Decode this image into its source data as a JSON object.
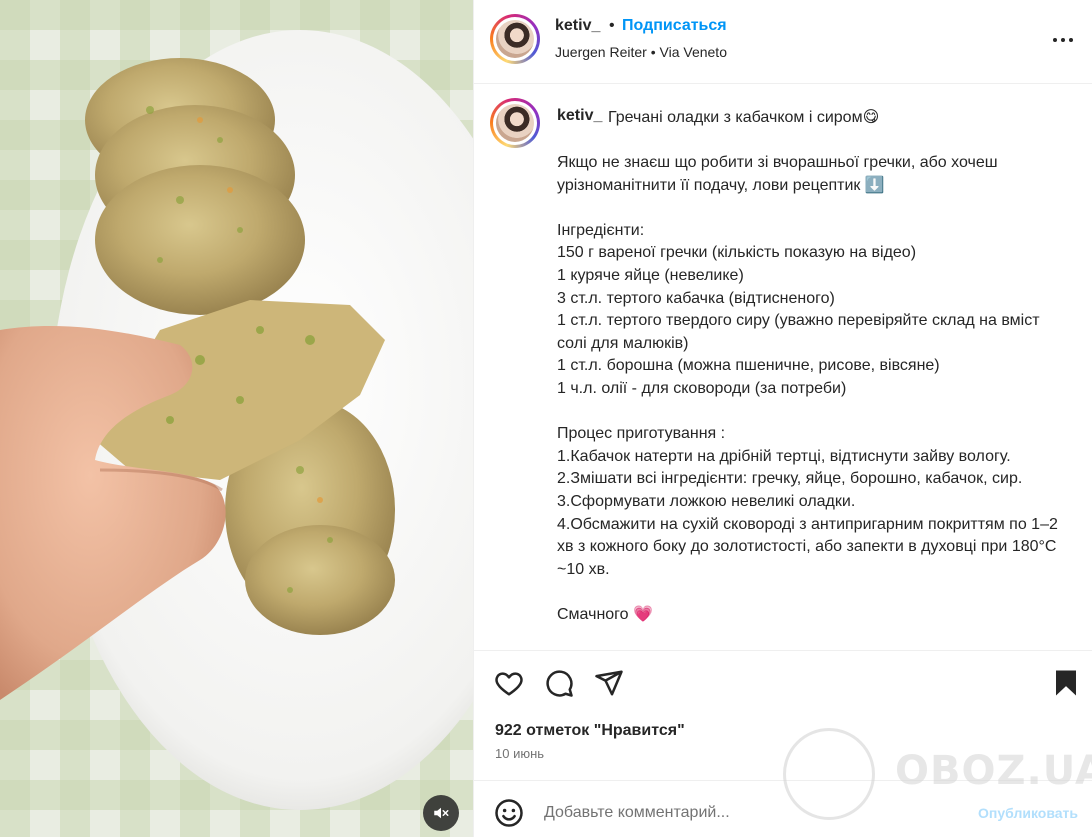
{
  "header": {
    "username": "ketiv_",
    "separator": "•",
    "follow_label": "Подписаться",
    "location": "Juergen Reiter • Via Veneto",
    "more_icon": "more-horizontal-icon"
  },
  "caption": {
    "username": "ketiv_",
    "title": "Гречані оладки з кабачком і сиром😋",
    "body": "Якщо не знаєш що робити зі вчорашньої гречки, або хочеш урізноманітнити її подачу, лови рецептик ⬇️\n\nІнгредієнти:\n150 г вареної гречки (кількість показую на відео)\n1 куряче яйце (невелике)\n3 ст.л. тертого кабачка (відтисненого)\n1 ст.л. тертого твердого сиру (уважно перевіряйте склад на вміст солі для малюків)\n1 ст.л. борошна (можна пшеничне, рисове, вівсяне)\n1 ч.л. олії - для сковороди (за потреби)\n\nПроцес приготування :\n1.Кабачок натерти на дрібній тертці, відтиснути зайву вологу.\n2.Змішати всі інгредієнти: гречку, яйце, борошно, кабачок, сир.\n3.Сформувати ложкою невеликі оладки.\n4.Обсмажити на сухій сковороді з антипригарним покриттям по 1–2 хв з кожного боку до золотистості, або запекти в духовці при 180°C ~10 хв.\n\nСмачного 💗"
  },
  "actions": {
    "like_icon": "heart-icon",
    "comment_icon": "comment-icon",
    "share_icon": "send-icon",
    "save_icon": "bookmark-icon",
    "likes_text": "922 отметок \"Нравится\"",
    "date": "10 июнь"
  },
  "comment": {
    "emoji_icon": "emoji-icon",
    "placeholder": "Добавьте комментарий...",
    "publish_label": "Опубликовать"
  },
  "media": {
    "mute_icon": "volume-off-icon"
  },
  "watermark": {
    "text": "OBOZ.UA"
  }
}
